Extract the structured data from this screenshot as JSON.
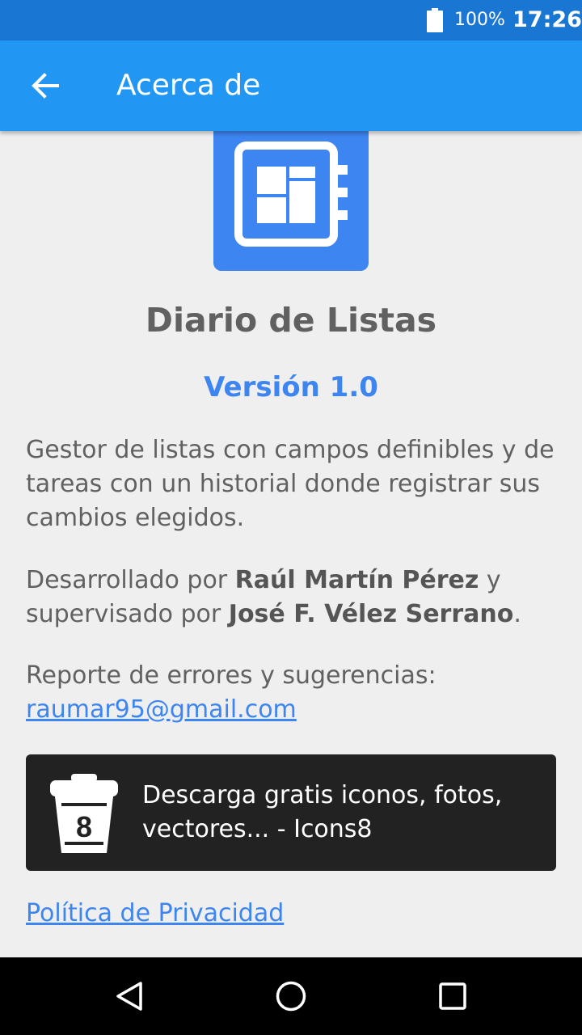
{
  "status_bar": {
    "battery_percent": "100%",
    "time": "17:26",
    "icons": [
      "battery-icon"
    ]
  },
  "app_bar": {
    "title": "Acerca de",
    "back_icon": "arrow-back-icon"
  },
  "about": {
    "app_name": "Diario de Listas",
    "version": "Versión 1.0",
    "description": "Gestor de listas con campos definibles y de tareas con un historial donde registrar sus cambios elegidos.",
    "credits": {
      "prefix": "Desarrollado por ",
      "developer": "Raúl Martín Pérez",
      "middle": " y supervisado por ",
      "supervisor": "José F. Vélez Serrano",
      "suffix": "."
    },
    "report_label": "Reporte de errores y sugerencias:",
    "email": "raumar95@gmail.com",
    "icons8_banner": {
      "text": "Descarga gratis iconos, fotos, vectores... - Icons8",
      "logo_text": "8"
    },
    "privacy_link": "Política de Privacidad"
  },
  "nav_bar": {
    "icons": [
      "back-triangle-icon",
      "home-circle-icon",
      "recents-square-icon"
    ]
  },
  "colors": {
    "status_bar": "#1976d2",
    "app_bar": "#2196f3",
    "accent": "#3d85f0",
    "background": "#efefef",
    "text": "#616161",
    "banner": "#222222"
  }
}
